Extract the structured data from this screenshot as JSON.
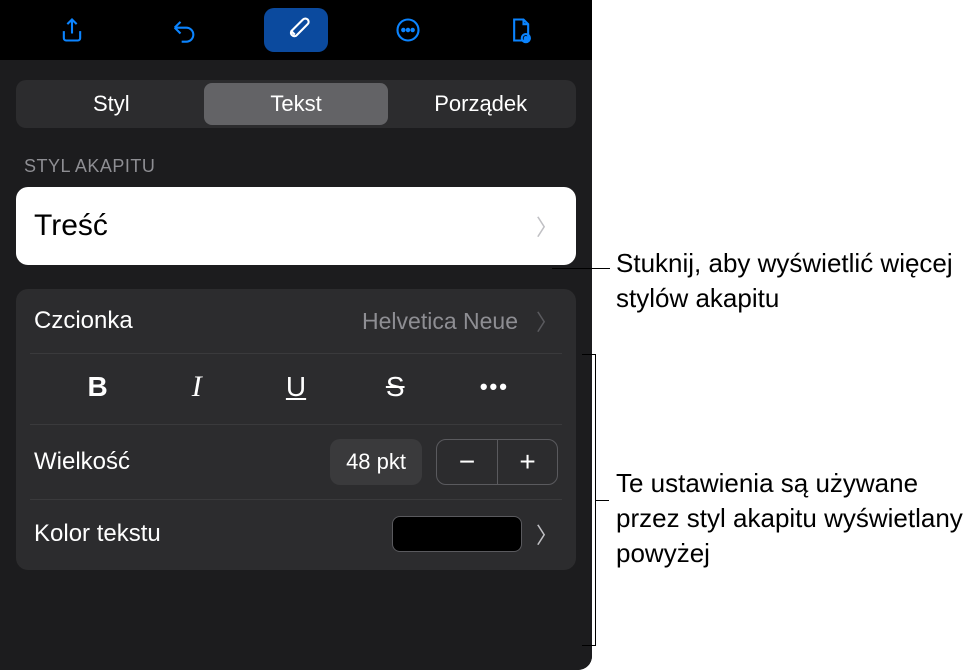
{
  "toolbar": {
    "share": "share-icon",
    "undo": "undo-icon",
    "format": "brush-icon",
    "more": "more-icon",
    "document": "document-icon"
  },
  "tabs": {
    "style": "Styl",
    "text": "Tekst",
    "arrange": "Porządek"
  },
  "section": {
    "paragraph_style_label": "STYL AKAPITU",
    "paragraph_style_value": "Treść"
  },
  "font": {
    "label": "Czcionka",
    "value": "Helvetica Neue"
  },
  "format": {
    "bold": "B",
    "italic": "I",
    "underline": "U",
    "strike": "S",
    "more": "•••"
  },
  "size": {
    "label": "Wielkość",
    "value": "48 pkt",
    "minus": "−",
    "plus": "+"
  },
  "color": {
    "label": "Kolor tekstu",
    "value": "#000000"
  },
  "callouts": {
    "c1": "Stuknij, aby wyświetlić więcej stylów akapitu",
    "c2": "Te ustawienia są używane przez styl akapitu wyświetlany powyżej"
  }
}
